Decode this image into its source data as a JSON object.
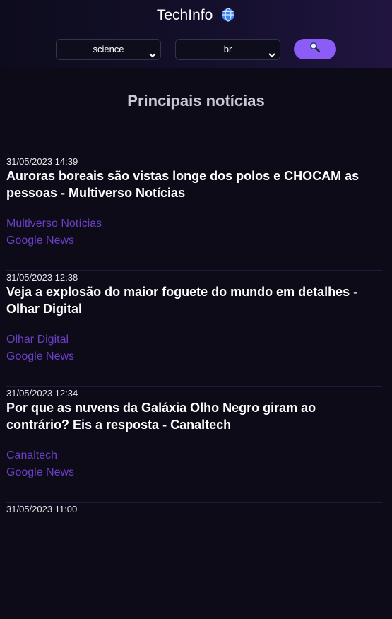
{
  "app": {
    "title": "TechInfo",
    "icon": "globe-icon"
  },
  "filters": {
    "category": "science",
    "country": "br",
    "search_icon": "magnifier-icon"
  },
  "section_title": "Principais notícias",
  "colors": {
    "accent": "#8b5cf6",
    "link": "#6c3fc7",
    "background": "#0c0b17"
  },
  "articles": [
    {
      "date": "31/05/2023 14:39",
      "title": "Auroras boreais são vistas longe dos polos e CHOCAM as pessoas - Multiverso Notícias",
      "source": "Multiverso Notícias",
      "aggregator": "Google News"
    },
    {
      "date": "31/05/2023 12:38",
      "title": "Veja a explosão do maior foguete do mundo em detalhes - Olhar Digital",
      "source": "Olhar Digital",
      "aggregator": "Google News"
    },
    {
      "date": "31/05/2023 12:34",
      "title": "Por que as nuvens da Galáxia Olho Negro giram ao contrário? Eis a resposta - Canaltech",
      "source": "Canaltech",
      "aggregator": "Google News"
    },
    {
      "date": "31/05/2023 11:00",
      "title": "",
      "source": "",
      "aggregator": ""
    }
  ]
}
